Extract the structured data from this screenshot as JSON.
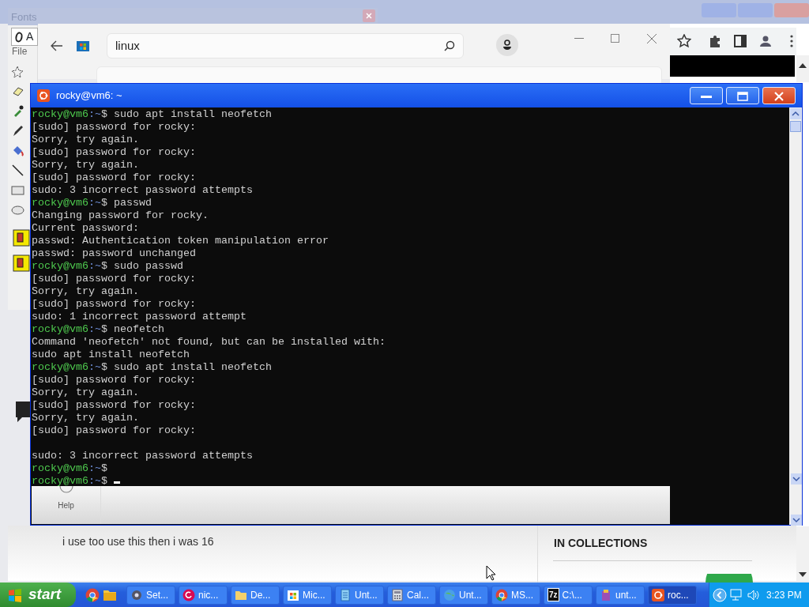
{
  "fonts_dialog": {
    "title": "Fonts",
    "font_name": "A"
  },
  "paint": {
    "menu": "File"
  },
  "store": {
    "search": {
      "value": "linux"
    },
    "nav": [
      {
        "label": "Help"
      }
    ]
  },
  "terminal": {
    "title": "rocky@vm6: ~",
    "lines": [
      {
        "kind": "prompt",
        "user": "rocky@vm6",
        "path": ":~",
        "command": "$ sudo apt install neofetch"
      },
      {
        "kind": "output",
        "text": "[sudo] password for rocky:"
      },
      {
        "kind": "output",
        "text": "Sorry, try again."
      },
      {
        "kind": "output",
        "text": "[sudo] password for rocky:"
      },
      {
        "kind": "output",
        "text": "Sorry, try again."
      },
      {
        "kind": "output",
        "text": "[sudo] password for rocky:"
      },
      {
        "kind": "output",
        "text": "sudo: 3 incorrect password attempts"
      },
      {
        "kind": "prompt",
        "user": "rocky@vm6",
        "path": ":~",
        "command": "$ passwd"
      },
      {
        "kind": "output",
        "text": "Changing password for rocky."
      },
      {
        "kind": "output",
        "text": "Current password:"
      },
      {
        "kind": "output",
        "text": "passwd: Authentication token manipulation error"
      },
      {
        "kind": "output",
        "text": "passwd: password unchanged"
      },
      {
        "kind": "prompt",
        "user": "rocky@vm6",
        "path": ":~",
        "command": "$ sudo passwd"
      },
      {
        "kind": "output",
        "text": "[sudo] password for rocky:"
      },
      {
        "kind": "output",
        "text": "Sorry, try again."
      },
      {
        "kind": "output",
        "text": "[sudo] password for rocky:"
      },
      {
        "kind": "output",
        "text": "sudo: 1 incorrect password attempt"
      },
      {
        "kind": "prompt",
        "user": "rocky@vm6",
        "path": ":~",
        "command": "$ neofetch"
      },
      {
        "kind": "output",
        "text": "Command 'neofetch' not found, but can be installed with:"
      },
      {
        "kind": "output",
        "text": "sudo apt install neofetch"
      },
      {
        "kind": "prompt",
        "user": "rocky@vm6",
        "path": ":~",
        "command": "$ sudo apt install neofetch"
      },
      {
        "kind": "output",
        "text": "[sudo] password for rocky:"
      },
      {
        "kind": "output",
        "text": "Sorry, try again."
      },
      {
        "kind": "output",
        "text": "[sudo] password for rocky:"
      },
      {
        "kind": "output",
        "text": "Sorry, try again."
      },
      {
        "kind": "output",
        "text": "[sudo] password for rocky:"
      },
      {
        "kind": "blank"
      },
      {
        "kind": "output",
        "text": "sudo: 3 incorrect password attempts"
      },
      {
        "kind": "prompt",
        "user": "rocky@vm6",
        "path": ":~",
        "command": "$"
      },
      {
        "kind": "prompt",
        "user": "rocky@vm6",
        "path": ":~",
        "command": "$",
        "cursor": true
      }
    ]
  },
  "browser": {
    "comment": "i use too use this then i was 16",
    "section": "IN COLLECTIONS"
  },
  "taskbar": {
    "start": "start",
    "tasks": [
      {
        "kind": "settings",
        "label": "Set...",
        "selected": false
      },
      {
        "kind": "debian",
        "label": "nic...",
        "selected": false
      },
      {
        "kind": "folder",
        "label": "De...",
        "selected": false
      },
      {
        "kind": "store",
        "label": "Mic...",
        "selected": false
      },
      {
        "kind": "notepad",
        "label": "Unt...",
        "selected": false
      },
      {
        "kind": "calculator",
        "label": "Cal...",
        "selected": false
      },
      {
        "kind": "globe",
        "label": "Unt...",
        "selected": false
      },
      {
        "kind": "chrome",
        "label": "MS...",
        "selected": false
      },
      {
        "kind": "sevenzip",
        "icon_text": "7z",
        "label": "C:\\...",
        "selected": false
      },
      {
        "kind": "archive",
        "label": "unt...",
        "selected": false
      },
      {
        "kind": "ubuntu",
        "label": "roc...",
        "selected": true
      }
    ],
    "clock": "3:23 PM"
  }
}
